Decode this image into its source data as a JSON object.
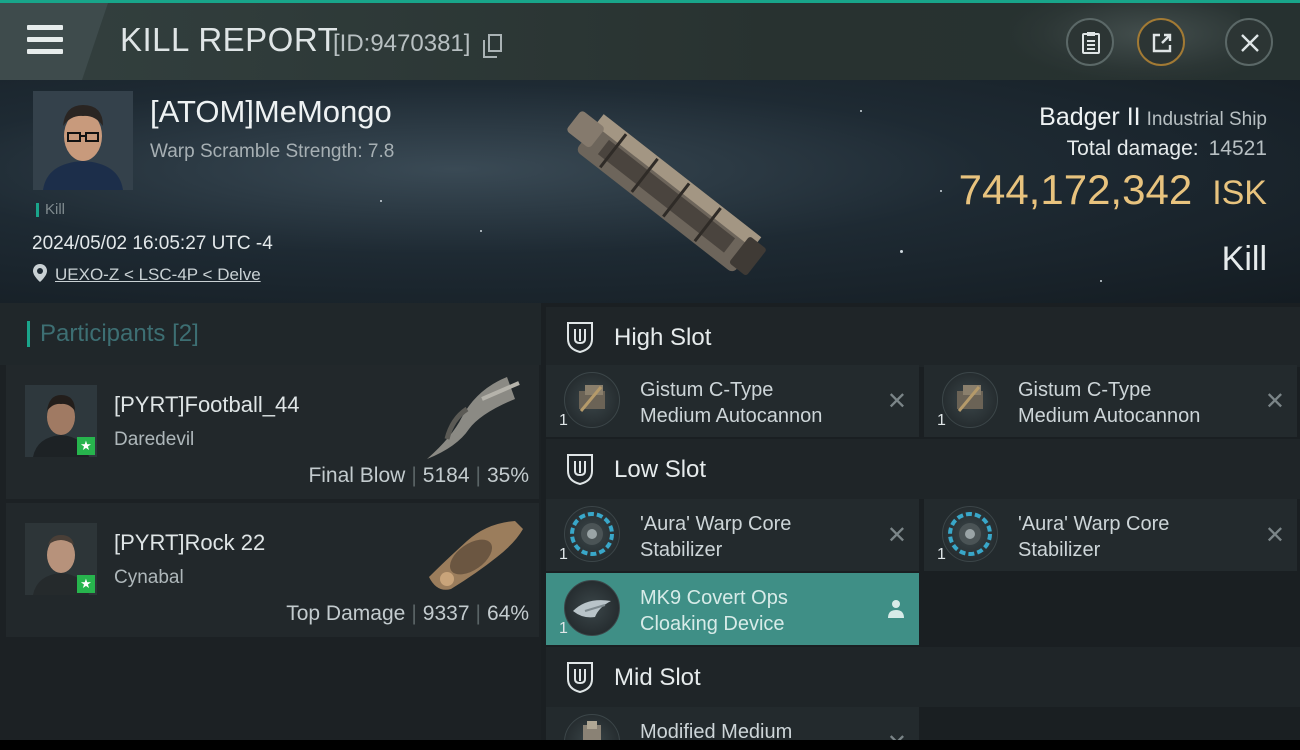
{
  "header": {
    "title": "KILL REPORT",
    "report_id": "[ID:9470381]"
  },
  "victim": {
    "name": "[ATOM]MeMongo",
    "subtitle": "Warp Scramble Strength: 7.8",
    "tag": "Kill",
    "datetime": "2024/05/02 16:05:27 UTC -4",
    "location": "UEXO-Z < LSC-4P < Delve",
    "ship_name": "Badger II",
    "ship_class": "Industrial Ship",
    "total_damage_label": "Total damage:",
    "total_damage": "14521",
    "isk_value": "744,172,342",
    "isk_unit": "ISK",
    "result": "Kill"
  },
  "participants": {
    "label": "Participants",
    "count": "[2]",
    "list": [
      {
        "name": "[PYRT]Football_44",
        "ship": "Daredevil",
        "role": "Final Blow",
        "damage": "5184",
        "percent": "35%"
      },
      {
        "name": "[PYRT]Rock 22",
        "ship": "Cynabal",
        "role": "Top Damage",
        "damage": "9337",
        "percent": "64%"
      }
    ]
  },
  "slots": {
    "high": {
      "title": "High Slot",
      "items": [
        {
          "qty": "1",
          "line1": "Gistum C-Type",
          "line2": "Medium Autocannon"
        },
        {
          "qty": "1",
          "line1": "Gistum C-Type",
          "line2": "Medium Autocannon"
        }
      ]
    },
    "low": {
      "title": "Low Slot",
      "items": [
        {
          "qty": "1",
          "line1": "'Aura' Warp Core",
          "line2": "Stabilizer"
        },
        {
          "qty": "1",
          "line1": "'Aura' Warp Core",
          "line2": "Stabilizer"
        },
        {
          "qty": "1",
          "line1": "MK9 Covert Ops",
          "line2": "Cloaking Device"
        }
      ]
    },
    "mid": {
      "title": "Mid Slot",
      "items": [
        {
          "qty": "1",
          "line1": "Modified Medium",
          "line2": ""
        }
      ]
    }
  },
  "icons": {
    "menu": "hamburger-icon",
    "copy": "copy-icon",
    "clipboard": "clipboard-icon",
    "share": "share-icon",
    "close": "close-icon",
    "location": "location-pin-icon",
    "slot": "slot-shield-icon",
    "remove": "x-icon",
    "pilot": "person-icon"
  },
  "colors": {
    "accent": "#1aa58b",
    "isk": "#e8c37e",
    "highlight_item": "#3f8f86",
    "corp_star": "#27b44d"
  }
}
